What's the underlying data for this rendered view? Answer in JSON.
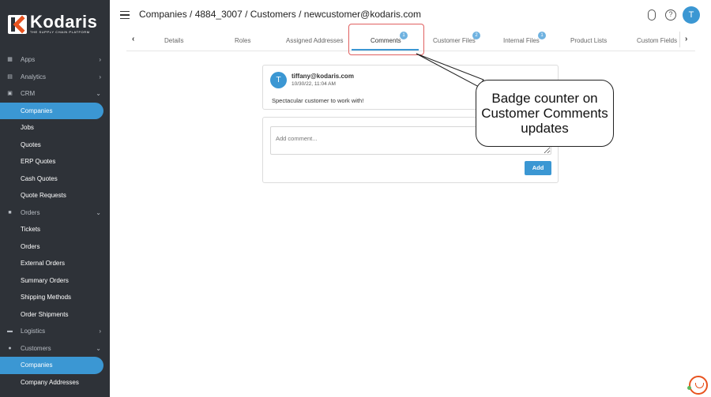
{
  "brand": {
    "name": "Kodaris",
    "tagline": "THE SUPPLY CHAIN PLATFORM",
    "accent": "#3b97d3",
    "logo_accent": "#e8531f",
    "sidebar_bg": "#2e3238"
  },
  "header": {
    "breadcrumb": "Companies / 4884_3007 / Customers / newcustomer@kodaris.com",
    "avatar_initial": "T"
  },
  "sidebar": {
    "items": [
      {
        "label": "Apps",
        "icon": "grid-icon",
        "chevron": "›"
      },
      {
        "label": "Analytics",
        "icon": "chart-icon",
        "chevron": "›"
      },
      {
        "label": "CRM",
        "icon": "contact-icon",
        "chevron": "⌄"
      },
      {
        "label": "Companies"
      },
      {
        "label": "Jobs"
      },
      {
        "label": "Quotes"
      },
      {
        "label": "ERP Quotes"
      },
      {
        "label": "Cash Quotes"
      },
      {
        "label": "Quote Requests"
      },
      {
        "label": "Orders",
        "icon": "truck-icon",
        "chevron": "⌄"
      },
      {
        "label": "Tickets"
      },
      {
        "label": "Orders"
      },
      {
        "label": "External Orders"
      },
      {
        "label": "Summary Orders"
      },
      {
        "label": "Shipping Methods"
      },
      {
        "label": "Order Shipments"
      },
      {
        "label": "Logistics",
        "icon": "logistics-icon",
        "chevron": "›"
      },
      {
        "label": "Customers",
        "icon": "users-icon",
        "chevron": "⌄"
      },
      {
        "label": "Companies"
      },
      {
        "label": "Company Addresses"
      }
    ]
  },
  "tabs": {
    "items": [
      {
        "label": "Details"
      },
      {
        "label": "Roles"
      },
      {
        "label": "Assigned Addresses"
      },
      {
        "label": "Comments",
        "badge": "1"
      },
      {
        "label": "Customer Files",
        "badge": "2"
      },
      {
        "label": "Internal Files",
        "badge": "1"
      },
      {
        "label": "Product Lists"
      },
      {
        "label": "Custom Fields"
      }
    ],
    "active": "Comments"
  },
  "comment": {
    "avatar_initial": "T",
    "author": "tiffany@kodaris.com",
    "timestamp": "10/30/22, 11:04 AM",
    "text": "Spectacular customer to work with!"
  },
  "new_comment": {
    "placeholder": "Add comment...",
    "add_label": "Add"
  },
  "callout": {
    "text": "Badge counter on Customer Comments updates"
  }
}
